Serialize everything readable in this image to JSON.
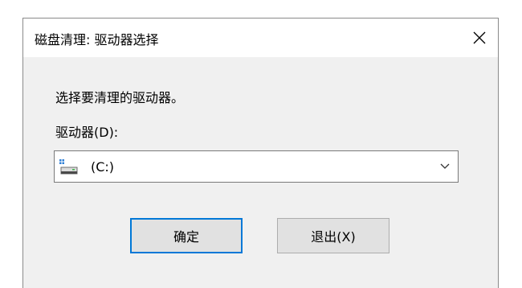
{
  "window": {
    "title": "磁盘清理: 驱动器选择",
    "close_icon": "close-icon"
  },
  "content": {
    "prompt": "选择要清理的驱动器。",
    "drive_label": "驱动器(D):"
  },
  "drive_select": {
    "selected_value": "(C:)",
    "icon": "hard-drive-icon",
    "dropdown_icon": "chevron-down-icon"
  },
  "buttons": {
    "ok_label": "确定",
    "exit_label": "退出(X)"
  },
  "colors": {
    "dialog_bg": "#f0f0f0",
    "titlebar_bg": "#ffffff",
    "default_button_border": "#0078d7",
    "button_bg": "#e1e1e1"
  }
}
